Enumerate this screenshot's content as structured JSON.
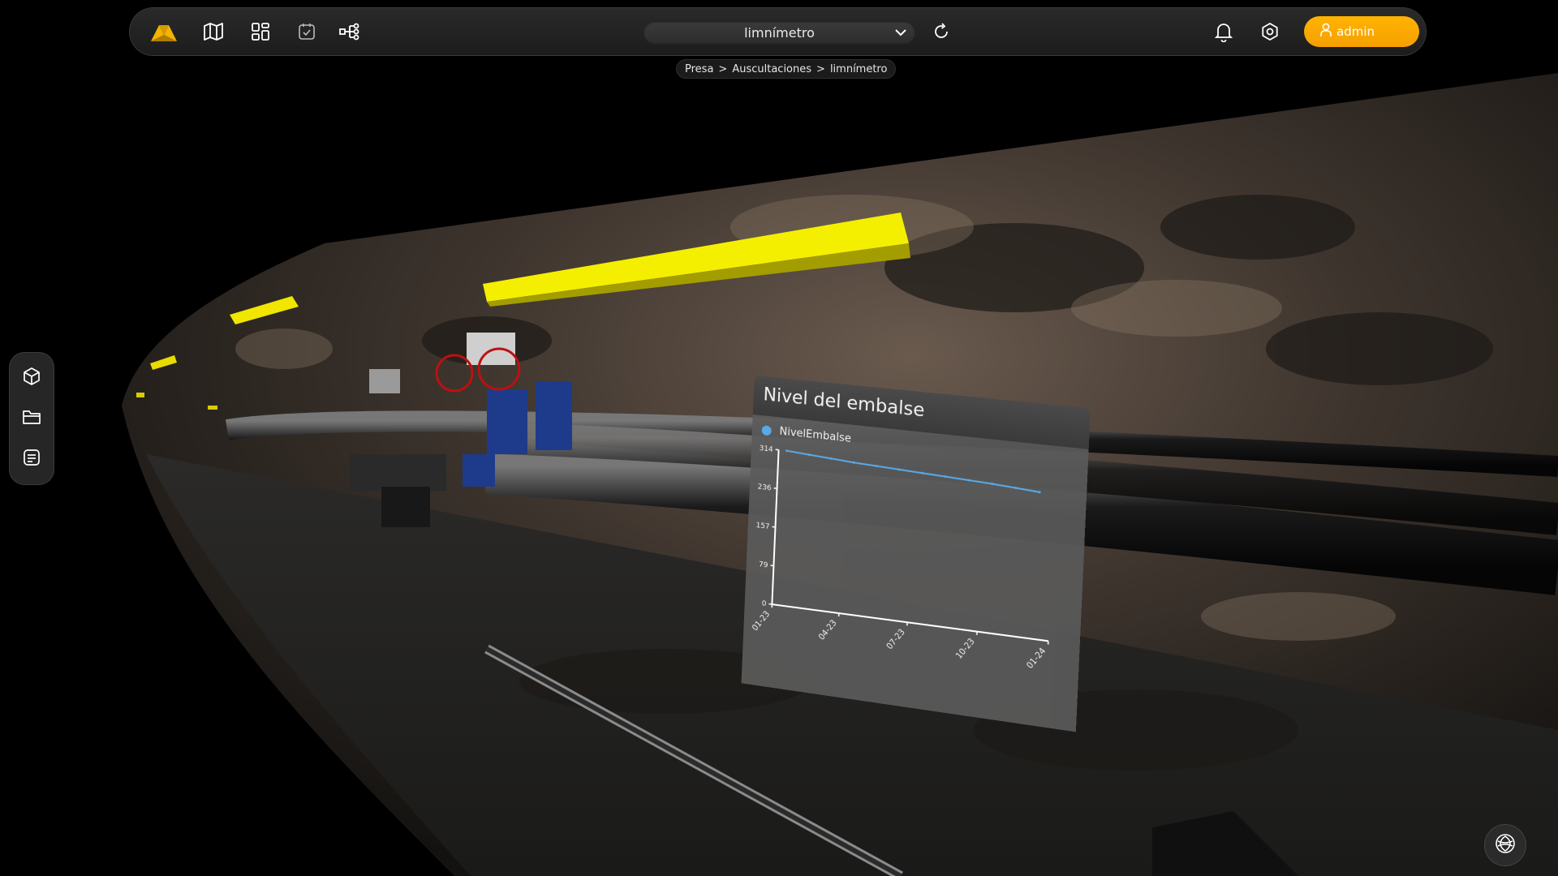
{
  "app": {
    "sensor_select": {
      "value": "limnímetro"
    },
    "user": {
      "label": "admin"
    }
  },
  "breadcrumb": [
    "Presa",
    "Auscultaciones",
    "limnímetro"
  ],
  "toolbar": {
    "icons": [
      "logo-icon",
      "map-icon",
      "dashboard-grid-icon",
      "calendar-check-icon",
      "workflow-icon"
    ],
    "right_icons": [
      "refresh-icon",
      "bell-icon",
      "settings-icon",
      "user-icon"
    ]
  },
  "sidebar": {
    "items": [
      {
        "icon": "cube-icon"
      },
      {
        "icon": "folder-icon"
      },
      {
        "icon": "notes-icon"
      }
    ]
  },
  "colors": {
    "accent": "#ffb400",
    "series": "#5aa9e6",
    "lamp": "#f5f200"
  },
  "chart_data": {
    "type": "line",
    "title": "Nivel del embalse",
    "x_tick_labels": [
      "01-23",
      "04-23",
      "07-23",
      "10-23",
      "01-24"
    ],
    "y_tick_labels": [
      "0",
      "79",
      "157",
      "236",
      "314"
    ],
    "ylim": [
      0,
      314
    ],
    "series": [
      {
        "name": "NivelEmbalse",
        "x": [
          "01-23",
          "02-23",
          "03-23",
          "04-23",
          "05-23",
          "06-23",
          "07-23",
          "08-23",
          "09-23",
          "10-23",
          "11-23",
          "12-23"
        ],
        "values": [
          314,
          311,
          308,
          305,
          303,
          301,
          299,
          297,
          295,
          293,
          290,
          287
        ]
      }
    ],
    "legend": "top-left",
    "grid": false
  }
}
